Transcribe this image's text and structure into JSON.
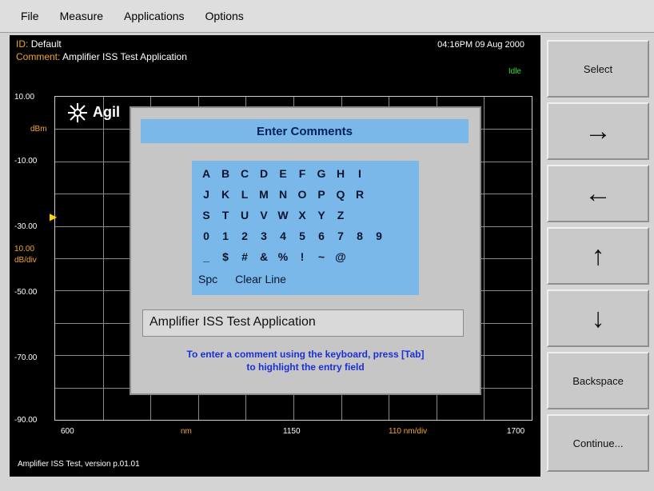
{
  "menu": [
    "File",
    "Measure",
    "Applications",
    "Options"
  ],
  "header": {
    "id_label": "ID:",
    "id_value": "Default",
    "comment_label": "Comment:",
    "comment_value": "Amplifier ISS Test Application",
    "datetime": "04:16PM 09 Aug 2000",
    "status": "Idle"
  },
  "y_axis": {
    "ticks": [
      "10.00",
      "-10.00",
      "-30.00",
      "-50.00",
      "-70.00",
      "-90.00"
    ],
    "unit": "dBm",
    "scale_value": "10.00",
    "scale_unit": "dB/div"
  },
  "x_axis": {
    "start": "600",
    "unit": "nm",
    "center": "1150",
    "per_div": "110 nm/div",
    "stop": "1700"
  },
  "logo_text": "Agil",
  "footer": "Amplifier ISS Test, version p.01.01",
  "dialog": {
    "title": "Enter Comments",
    "rows": [
      [
        "A",
        "B",
        "C",
        "D",
        "E",
        "F",
        "G",
        "H",
        "I"
      ],
      [
        "J",
        "K",
        "L",
        "M",
        "N",
        "O",
        "P",
        "Q",
        "R"
      ],
      [
        "S",
        "T",
        "U",
        "V",
        "W",
        "X",
        "Y",
        "Z"
      ],
      [
        "0",
        "1",
        "2",
        "3",
        "4",
        "5",
        "6",
        "7",
        "8",
        "9"
      ],
      [
        "_",
        "$",
        "#",
        "&",
        "%",
        "!",
        "~",
        "@"
      ]
    ],
    "spc_label": "Spc",
    "clear_label": "Clear Line",
    "entry_value": "Amplifier ISS Test Application",
    "hint_line1": "To enter a comment using the keyboard, press [Tab]",
    "hint_line2": "to highlight the entry field"
  },
  "softkeys": {
    "select": "Select",
    "right": "→",
    "left": "←",
    "up": "↑",
    "down": "↓",
    "backspace": "Backspace",
    "continue": "Continue..."
  }
}
